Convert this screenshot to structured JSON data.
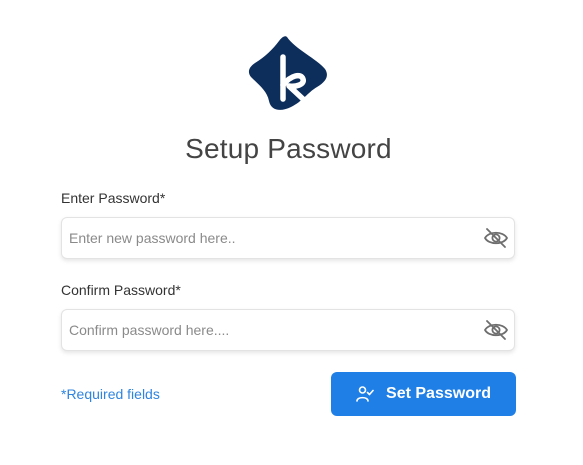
{
  "logo": {
    "icon": "k-brand-logo-icon",
    "color": "#0d2d5b",
    "letter": "k"
  },
  "title": "Setup Password",
  "fields": [
    {
      "label": "Enter Password*",
      "placeholder": "Enter new password here..",
      "value": "",
      "icon": "eye-slash-icon"
    },
    {
      "label": "Confirm Password*",
      "placeholder": "Confirm password here....",
      "value": "",
      "icon": "eye-slash-icon"
    }
  ],
  "required_note": "*Required fields",
  "submit": {
    "label": "Set Password",
    "icon": "user-check-icon"
  },
  "colors": {
    "accent": "#1f7fe6",
    "link": "#2f84e0",
    "brand": "#0d2d5b",
    "title": "#444444"
  }
}
